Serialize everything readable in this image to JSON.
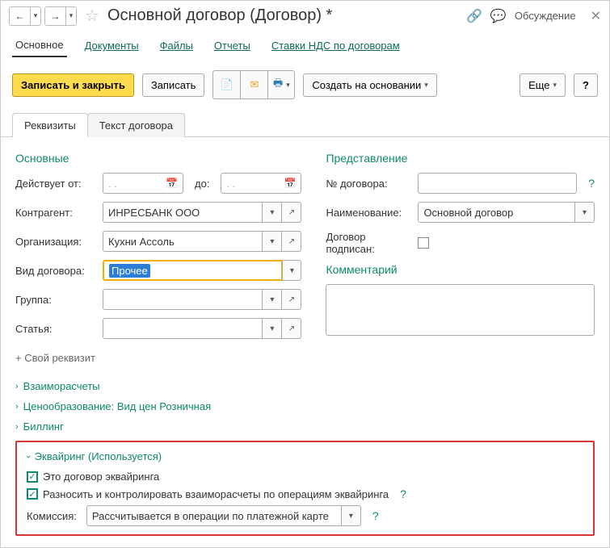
{
  "titlebar": {
    "title": "Основной договор (Договор) *",
    "discussion": "Обсуждение"
  },
  "toptabs": {
    "main": "Основное",
    "docs": "Документы",
    "files": "Файлы",
    "reports": "Отчеты",
    "vat": "Ставки НДС по договорам"
  },
  "toolbar": {
    "save_close": "Записать и закрыть",
    "save": "Записать",
    "create_based": "Создать на основании",
    "more": "Еще",
    "help": "?"
  },
  "subtabs": {
    "requisites": "Реквизиты",
    "text": "Текст договора"
  },
  "sections": {
    "main": "Основные",
    "repr": "Представление",
    "comment": "Комментарий"
  },
  "labels": {
    "valid_from": "Действует от:",
    "to": "до:",
    "counterparty": "Контрагент:",
    "org": "Организация:",
    "contract_type": "Вид договора:",
    "group": "Группа:",
    "article": "Статья:",
    "contract_no": "№ договора:",
    "name": "Наименование:",
    "signed": "Договор подписан:",
    "commission": "Комиссия:"
  },
  "values": {
    "date_placeholder": "  .   .",
    "counterparty": "ИНРЕСБАНК ООО",
    "org": "Кухни Ассоль",
    "contract_type": "Прочее",
    "name": "Основной договор",
    "commission": "Рассчитывается в операции по платежной карте"
  },
  "links": {
    "own_requisite": "+ Свой реквизит"
  },
  "collapsibles": {
    "settlements": "Взаиморасчеты",
    "pricing": "Ценообразование: Вид цен Розничная",
    "billing": "Биллинг",
    "acquiring": "Эквайринг (Используется)"
  },
  "acquiring": {
    "is_acquiring": "Это договор эквайринга",
    "control": "Разносить и контролировать взаиморасчеты по операциям эквайринга"
  }
}
